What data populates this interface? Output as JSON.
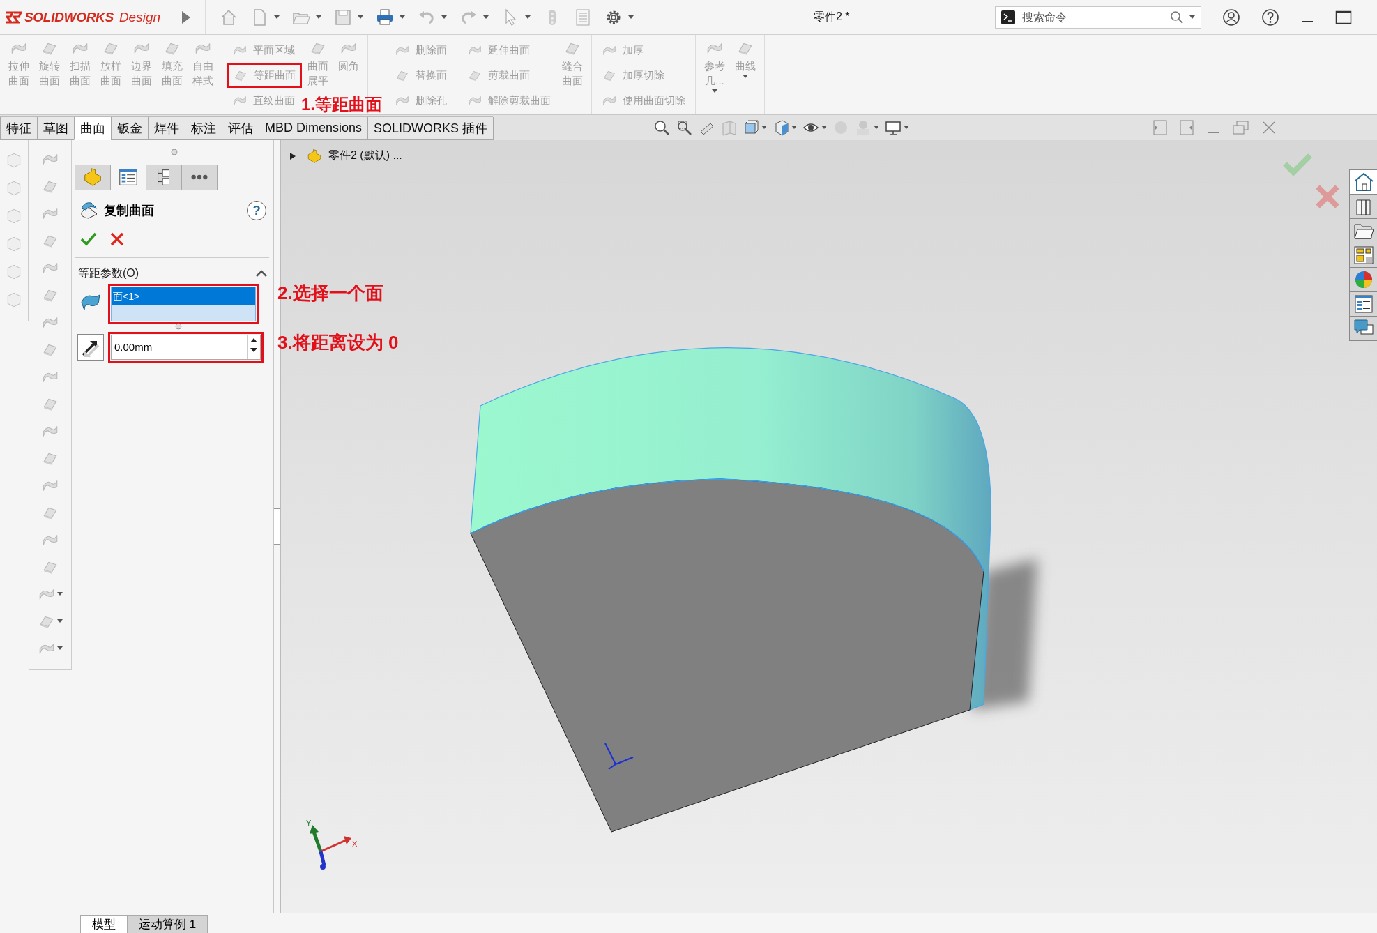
{
  "title_bar": {
    "brand": "SOLIDWORKS",
    "edition": "Design",
    "document_title": "零件2 *",
    "search": {
      "placeholder": "搜索命令"
    }
  },
  "ribbon": {
    "groups": [
      {
        "items": [
          {
            "kind": "large",
            "label": "拉伸曲面",
            "disabled": true,
            "dropdown": false
          },
          {
            "kind": "large",
            "label": "旋转曲面",
            "disabled": true,
            "dropdown": false
          },
          {
            "kind": "large",
            "label": "扫描曲面",
            "disabled": true,
            "dropdown": false
          },
          {
            "kind": "large",
            "label": "放样曲面",
            "disabled": true,
            "dropdown": false
          },
          {
            "kind": "large",
            "label": "边界曲面",
            "disabled": true,
            "dropdown": false
          },
          {
            "kind": "large",
            "label": "填充曲面",
            "disabled": true,
            "dropdown": false
          },
          {
            "kind": "large",
            "label": "自由样式",
            "disabled": true,
            "dropdown": false
          }
        ]
      },
      {
        "items": [
          {
            "kind": "stack",
            "buttons": [
              {
                "label": "平面区域",
                "disabled": true,
                "highlighted": false
              },
              {
                "label": "等距曲面",
                "disabled": true,
                "highlighted": true
              },
              {
                "label": "直纹曲面",
                "disabled": true,
                "highlighted": false
              }
            ]
          },
          {
            "kind": "large",
            "label": "曲面展平",
            "disabled": true,
            "dropdown": false
          },
          {
            "kind": "large",
            "label": "圆角",
            "disabled": true,
            "dropdown": false
          }
        ]
      },
      {
        "items": [
          {
            "kind": "stack",
            "buttons": [
              {
                "label": "删除面",
                "disabled": true,
                "highlighted": false
              },
              {
                "label": "替换面",
                "disabled": true,
                "highlighted": false
              },
              {
                "label": "删除孔",
                "disabled": true,
                "highlighted": false
              }
            ]
          }
        ]
      },
      {
        "items": [
          {
            "kind": "stack",
            "buttons": [
              {
                "label": "延伸曲面",
                "disabled": true,
                "highlighted": false
              },
              {
                "label": "剪裁曲面",
                "disabled": true,
                "highlighted": false
              },
              {
                "label": "解除剪裁曲面",
                "disabled": true,
                "highlighted": false
              }
            ]
          },
          {
            "kind": "large",
            "label": "缝合曲面",
            "disabled": true,
            "dropdown": false
          }
        ]
      },
      {
        "items": [
          {
            "kind": "stack",
            "buttons": [
              {
                "label": "加厚",
                "disabled": true,
                "highlighted": false
              },
              {
                "label": "加厚切除",
                "disabled": true,
                "highlighted": false
              },
              {
                "label": "使用曲面切除",
                "disabled": true,
                "highlighted": false
              }
            ]
          }
        ]
      },
      {
        "items": [
          {
            "kind": "large",
            "label": "参考几...",
            "disabled": true,
            "dropdown": true
          },
          {
            "kind": "large",
            "label": "曲线",
            "disabled": true,
            "dropdown": true
          }
        ]
      }
    ]
  },
  "command_tabs": [
    {
      "label": "特征",
      "selected": false
    },
    {
      "label": "草图",
      "selected": false
    },
    {
      "label": "曲面",
      "selected": true
    },
    {
      "label": "钣金",
      "selected": false
    },
    {
      "label": "焊件",
      "selected": false
    },
    {
      "label": "标注",
      "selected": false
    },
    {
      "label": "评估",
      "selected": false
    },
    {
      "label": "MBD Dimensions",
      "selected": false
    },
    {
      "label": "SOLIDWORKS 插件",
      "selected": false
    }
  ],
  "property_manager": {
    "tabs": [
      {
        "kind": "feature_manager",
        "selected": false
      },
      {
        "kind": "property_manager",
        "selected": true
      },
      {
        "kind": "configuration_manager",
        "selected": false
      },
      {
        "kind": "more",
        "selected": false
      }
    ],
    "title": "复制曲面",
    "help": "?",
    "section": {
      "title": "等距参数(O)",
      "expanded": true,
      "faces_highlighted": true,
      "faces": [
        {
          "label": "面<1>",
          "selected": true
        }
      ],
      "distance": {
        "value": "0.00mm",
        "highlighted": true
      }
    }
  },
  "viewport": {
    "tree": {
      "label": "零件2 (默认) ...",
      "expanded": false
    },
    "triad": {
      "x": "X",
      "y": "Y"
    }
  },
  "task_pane": {
    "tabs": [
      {
        "kind": "home",
        "selected": true
      },
      {
        "kind": "library",
        "selected": false
      },
      {
        "kind": "explorer",
        "selected": false
      },
      {
        "kind": "view_palette",
        "selected": false
      },
      {
        "kind": "appearances",
        "selected": false
      },
      {
        "kind": "custom_properties",
        "selected": false
      },
      {
        "kind": "forum",
        "selected": false
      }
    ]
  },
  "annotations": [
    {
      "text": "1.等距曲面"
    },
    {
      "text": "2.选择一个面"
    },
    {
      "text": "3.将距离设为 0"
    }
  ],
  "bottom_tabs": [
    {
      "label": "模型",
      "selected": true
    },
    {
      "label": "运动算例 1",
      "selected": false
    }
  ]
}
